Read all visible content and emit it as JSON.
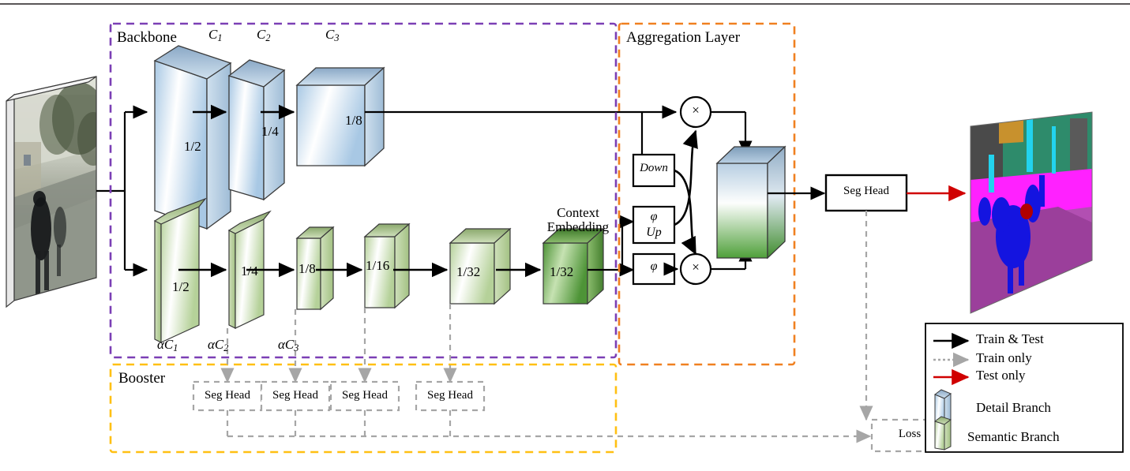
{
  "figure": {
    "type": "neural-network-architecture-diagram",
    "groups": [
      {
        "id": "backbone",
        "label": "Backbone",
        "border_color": "#7b3fb5",
        "style": "dashed"
      },
      {
        "id": "aggregation",
        "label": "Aggregation Layer",
        "border_color": "#f08020",
        "style": "dashed"
      },
      {
        "id": "booster",
        "label": "Booster",
        "border_color": "#ffc013",
        "style": "dashed"
      }
    ]
  },
  "input": {
    "name": "input-image",
    "description": "blurred street scene photograph"
  },
  "output": {
    "name": "segmentation-map",
    "description": "semantic segmentation result"
  },
  "detail_branch": {
    "color": "#b9d4ea",
    "top_labels": [
      "C1",
      "C2",
      "C3"
    ],
    "top_labels_text": [
      "C",
      "C",
      "C"
    ],
    "top_labels_sub": [
      "1",
      "2",
      "3"
    ],
    "scales": [
      "1/2",
      "1/4",
      "1/8"
    ]
  },
  "semantic_branch": {
    "color": "#c5ddb0",
    "scales": [
      "1/2",
      "1/4",
      "1/8",
      "1/16",
      "1/32",
      "1/32"
    ],
    "bottom_labels_text": [
      "αC",
      "αC",
      "αC"
    ],
    "bottom_labels_sub": [
      "1",
      "2",
      "3"
    ],
    "context_embedding_label_line1": "Context",
    "context_embedding_label_line2": "Embedding"
  },
  "aggregation": {
    "title": "Aggregation Layer",
    "down_label": "Down",
    "phi_up_label_line1": "φ",
    "phi_up_label_line2": "Up",
    "phi_label": "φ",
    "mul_symbol": "×",
    "fused_cube": "fused feature"
  },
  "seg_head": {
    "label": "Seg Head"
  },
  "booster": {
    "title": "Booster",
    "heads": [
      "Seg Head",
      "Seg Head",
      "Seg Head",
      "Seg Head"
    ]
  },
  "loss": {
    "label": "Loss"
  },
  "legend": {
    "items": [
      {
        "label": "Train & Test",
        "kind": "arrow",
        "color": "#000000",
        "style": "solid"
      },
      {
        "label": "Train only",
        "kind": "arrow",
        "color": "#a6a6a6",
        "style": "dotted"
      },
      {
        "label": "Test only",
        "kind": "arrow",
        "color": "#d00000",
        "style": "solid"
      },
      {
        "label": "Detail Branch",
        "kind": "cube",
        "color": "#b9d4ea"
      },
      {
        "label": "Semantic Branch",
        "kind": "cube",
        "color": "#c5ddb0"
      }
    ]
  },
  "colors": {
    "backbone_border": "#7b3fb5",
    "aggregation_border": "#f08020",
    "booster_border": "#ffc013",
    "train_only": "#a6a6a6",
    "test_only": "#d00000",
    "detail": "#b9d4ea",
    "semantic": "#c5ddb0",
    "context": "#5aa13c"
  }
}
